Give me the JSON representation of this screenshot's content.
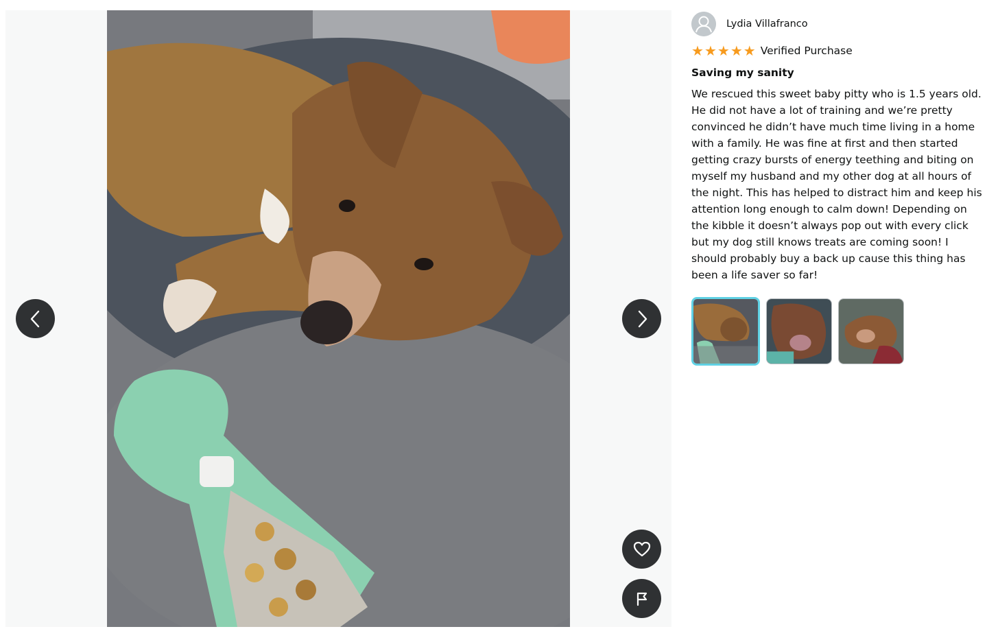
{
  "viewer": {
    "photo_alt_name": "customer review photo",
    "prev_icon": "chevron-left-icon",
    "next_icon": "chevron-right-icon",
    "like_icon": "heart-icon",
    "flag_icon": "flag-icon"
  },
  "review": {
    "author": "Lydia Villafranco",
    "rating": 5,
    "rating_max": 5,
    "verified_label": "Verified Purchase",
    "title": "Saving my sanity",
    "body": "We rescued this sweet baby pitty who is 1.5 years old. He did not have a lot of training and we’re pretty convinced he didn’t have much time living in a home with a family. He was fine at first and then started getting crazy bursts of energy teething and biting on myself my husband and my other dog at all hours of the night. This has helped to distract him and keep his attention long enough to calm down! Depending on the kibble it doesn’t always pop out with every click but my dog still knows treats are coming soon! I should probably buy a back up cause this thing has been a life saver so far!",
    "star_color": "#f79b1e",
    "thumbnails_selected_index": 0
  },
  "colors": {
    "button_bg": "#2f3133",
    "selected_thumb_border": "#5fd1e4"
  }
}
